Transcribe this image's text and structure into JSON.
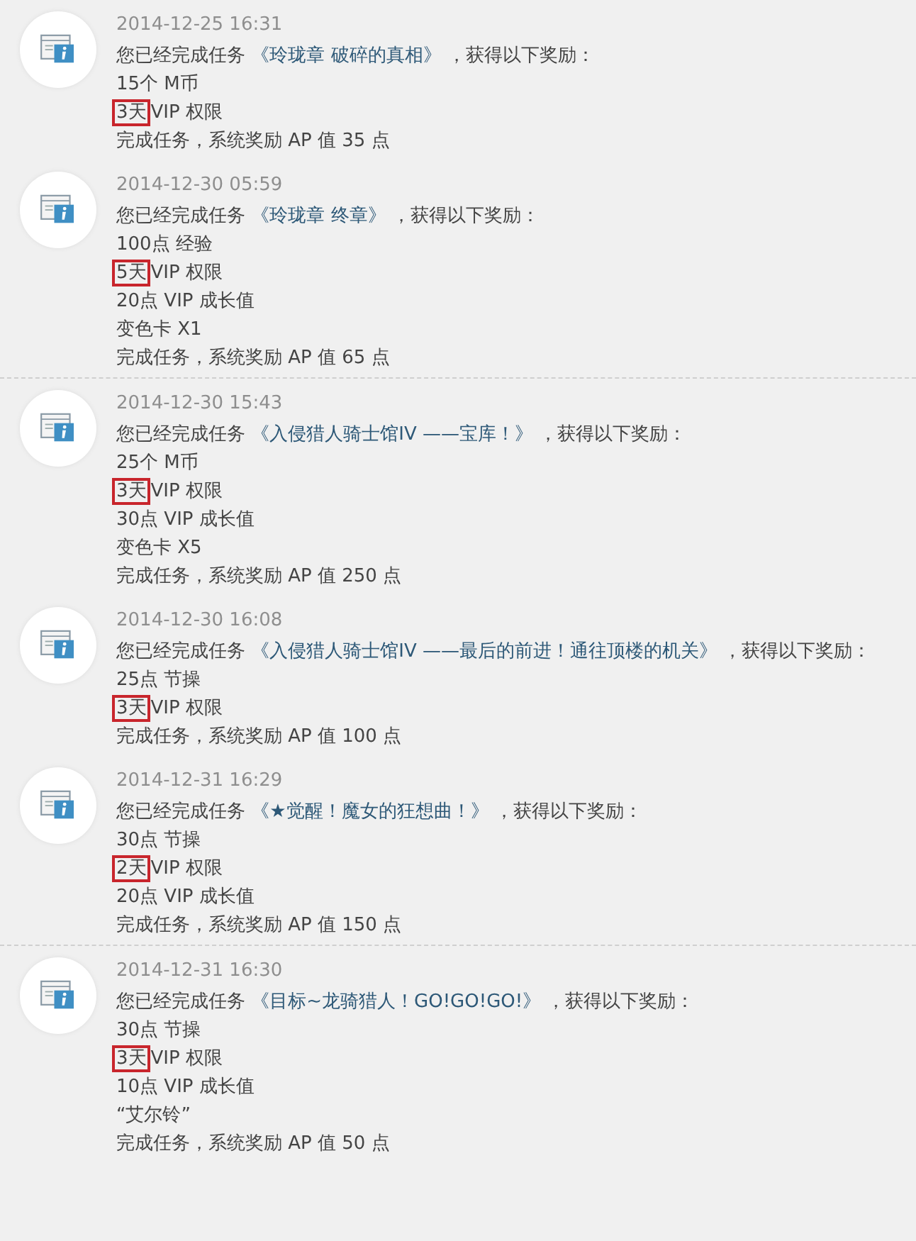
{
  "entries": [
    {
      "time": "2014-12-25 16:31",
      "prefix": "您已经完成任务",
      "task": "《玲珑章 破碎的真相》",
      "suffix": "，获得以下奖励：",
      "divider": false,
      "rewards": [
        {
          "text": "15个 M币"
        },
        {
          "marked": "3天",
          "text": "VIP 权限"
        },
        {
          "text": "完成任务，系统奖励 AP 值 35 点"
        }
      ]
    },
    {
      "time": "2014-12-30 05:59",
      "prefix": "您已经完成任务",
      "task": "《玲珑章 终章》",
      "suffix": "，获得以下奖励：",
      "divider": true,
      "rewards": [
        {
          "text": "100点 经验"
        },
        {
          "marked": "5天",
          "text": "VIP 权限"
        },
        {
          "text": "20点 VIP 成长值"
        },
        {
          "text": "变色卡 X1"
        },
        {
          "text": "完成任务，系统奖励 AP 值 65 点"
        }
      ]
    },
    {
      "time": "2014-12-30 15:43",
      "prefix": "您已经完成任务",
      "task": "《入侵猎人骑士馆IV ——宝库！》",
      "suffix": "，获得以下奖励：",
      "divider": false,
      "rewards": [
        {
          "text": "25个 M币"
        },
        {
          "marked": "3天",
          "text": "VIP 权限"
        },
        {
          "text": "30点 VIP 成长值"
        },
        {
          "text": "变色卡 X5"
        },
        {
          "text": "完成任务，系统奖励 AP 值 250 点"
        }
      ]
    },
    {
      "time": "2014-12-30 16:08",
      "prefix": "您已经完成任务",
      "task": "《入侵猎人骑士馆IV ——最后的前进！通往顶楼的机关》",
      "suffix": "，获得以下奖励：",
      "divider": false,
      "rewards": [
        {
          "text": "25点 节操"
        },
        {
          "marked": "3天",
          "text": "VIP 权限"
        },
        {
          "text": "完成任务，系统奖励 AP 值 100 点"
        }
      ]
    },
    {
      "time": "2014-12-31 16:29",
      "prefix": "您已经完成任务",
      "task": "《★觉醒！魔女的狂想曲！》",
      "suffix": "，获得以下奖励：",
      "divider": true,
      "rewards": [
        {
          "text": "30点 节操"
        },
        {
          "marked": "2天",
          "text": "VIP 权限"
        },
        {
          "text": "20点 VIP 成长值"
        },
        {
          "text": "完成任务，系统奖励 AP 值 150 点"
        }
      ]
    },
    {
      "time": "2014-12-31 16:30",
      "prefix": "您已经完成任务",
      "task": "《目标~龙骑猎人！GO!GO!GO!》",
      "suffix": "，获得以下奖励：",
      "divider": false,
      "rewards": [
        {
          "text": "30点 节操"
        },
        {
          "marked": "3天",
          "text": "VIP 权限"
        },
        {
          "text": "10点 VIP 成长值"
        },
        {
          "text": "“艾尔铃”"
        },
        {
          "text": "完成任务，系统奖励 AP 值 50 点"
        }
      ]
    }
  ]
}
